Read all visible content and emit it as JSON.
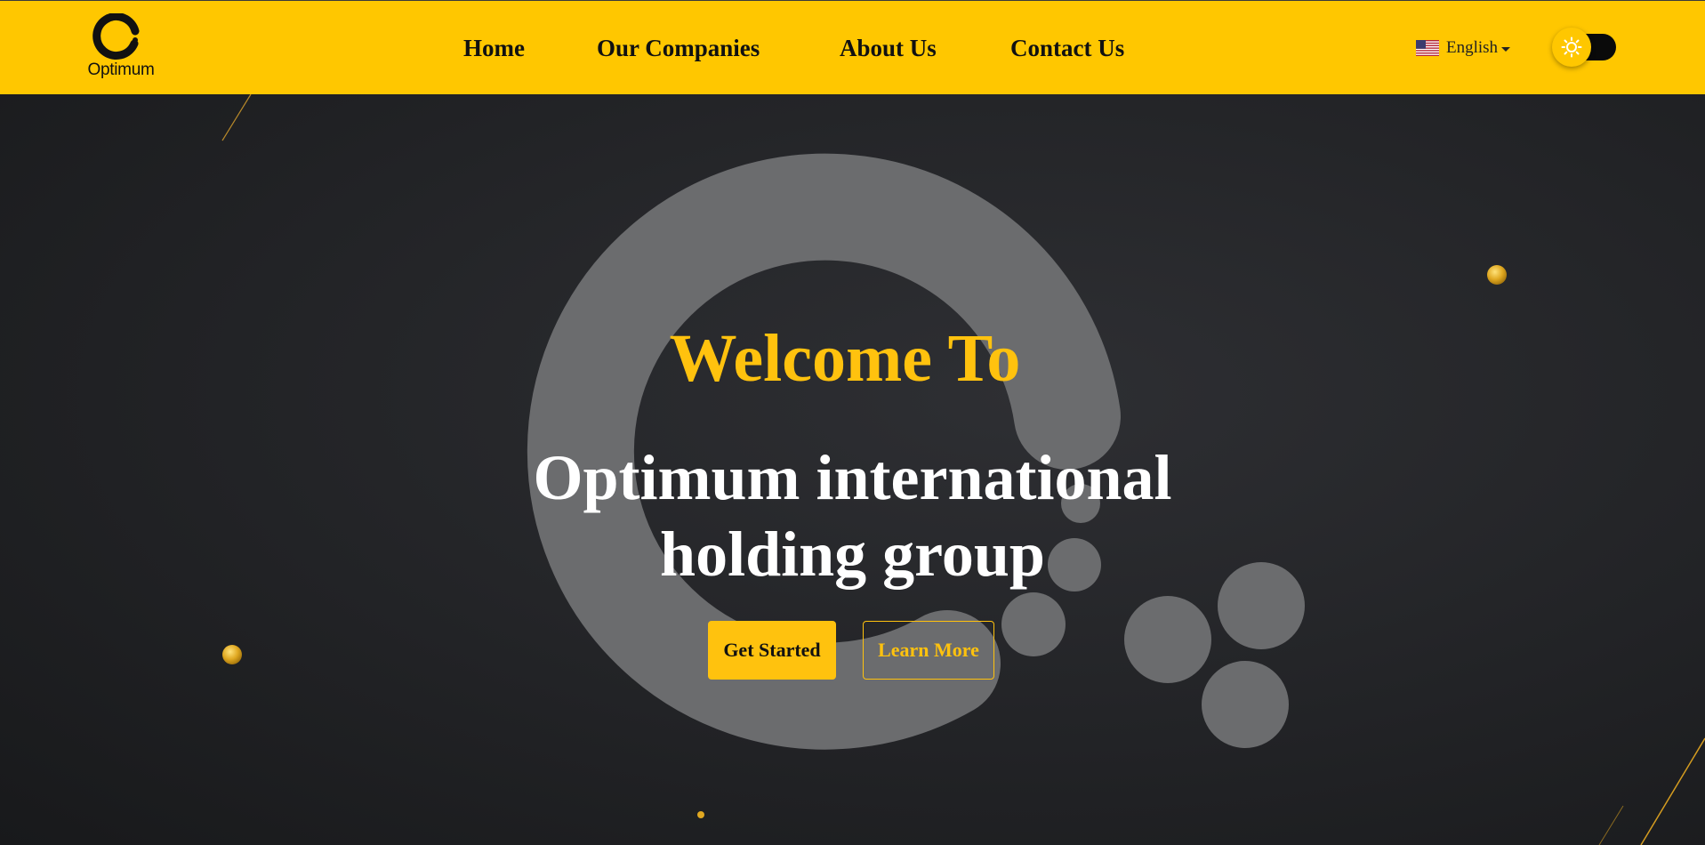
{
  "brand": {
    "logo_text": "Optimum",
    "accent_color": "#ffc700"
  },
  "nav": {
    "items": [
      {
        "label": "Home"
      },
      {
        "label": "Our Companies"
      },
      {
        "label": "About Us"
      },
      {
        "label": "Contact Us"
      }
    ]
  },
  "language": {
    "selected": "English",
    "flag_icon": "us-flag-icon"
  },
  "theme_toggle": {
    "icon": "sun-icon"
  },
  "hero": {
    "welcome": "Welcome To",
    "headline_line1": "Optimum international",
    "headline_line2": "holding group",
    "primary_button": "Get Started",
    "secondary_button": "Learn More",
    "heading_color": "#ffc20e"
  }
}
